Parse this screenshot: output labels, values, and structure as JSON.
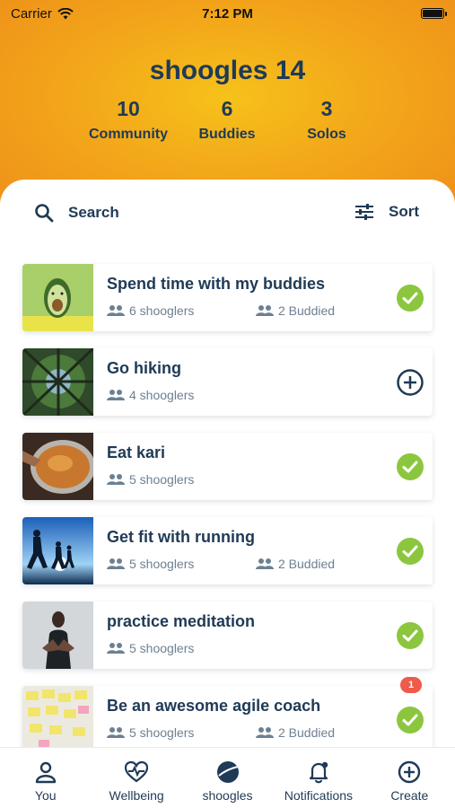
{
  "status_bar": {
    "carrier": "Carrier",
    "time": "7:12 PM"
  },
  "profile": {
    "title": "shoogles 14",
    "stats": [
      {
        "value": "10",
        "label": "Community"
      },
      {
        "value": "6",
        "label": "Buddies"
      },
      {
        "value": "3",
        "label": "Solos"
      }
    ]
  },
  "toolbar": {
    "search_label": "Search",
    "sort_label": "Sort"
  },
  "shoogles": [
    {
      "title": "Spend time with my buddies",
      "shooglers": "6 shooglers",
      "buddied": "2 Buddied",
      "status": "joined",
      "thumb": "avocado-plush"
    },
    {
      "title": "Go hiking",
      "shooglers": "4 shooglers",
      "buddied": "",
      "status": "add",
      "thumb": "forest-canopy"
    },
    {
      "title": "Eat kari",
      "shooglers": "5 shooglers",
      "buddied": "",
      "status": "joined",
      "thumb": "curry-pot"
    },
    {
      "title": "Get fit with running",
      "shooglers": "5 shooglers",
      "buddied": "2 Buddied",
      "status": "joined",
      "thumb": "runners-silhouette"
    },
    {
      "title": "practice meditation",
      "shooglers": "5 shooglers",
      "buddied": "",
      "status": "joined",
      "thumb": "meditating-person"
    },
    {
      "title": "Be an awesome agile coach",
      "shooglers": "5 shooglers",
      "buddied": "2 Buddied",
      "status": "joined",
      "thumb": "sticky-notes-board",
      "badge": "1"
    }
  ],
  "tab_bar": {
    "items": [
      {
        "label": "You",
        "icon": "person-icon"
      },
      {
        "label": "Wellbeing",
        "icon": "heart-pulse-icon"
      },
      {
        "label": "shoogles",
        "icon": "shoogles-logo-icon"
      },
      {
        "label": "Notifications",
        "icon": "bell-icon"
      },
      {
        "label": "Create",
        "icon": "plus-circle-icon"
      }
    ]
  },
  "colors": {
    "header_orange": "#f3a81a",
    "header_yellow": "#f6c21a",
    "navy": "#1f3a56",
    "check_green": "#8cc63f",
    "badge_red": "#ef5a4a"
  }
}
